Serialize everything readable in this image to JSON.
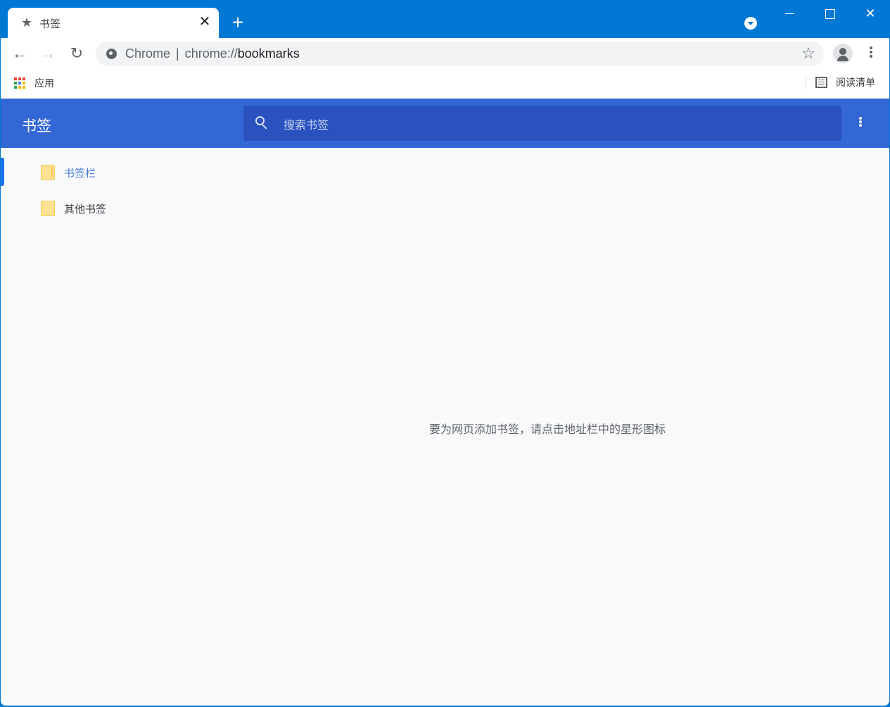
{
  "window": {
    "tab": {
      "title": "书签",
      "icon": "star-icon"
    },
    "new_tab_symbol": "+",
    "close_symbol": "✕"
  },
  "toolbar": {
    "back_symbol": "←",
    "forward_symbol": "→",
    "reload_symbol": "↻",
    "omnibox": {
      "site_label": "Chrome",
      "separator": "|",
      "url_scheme": "chrome://",
      "url_host": "bookmarks"
    },
    "star_symbol": "☆"
  },
  "bookmarks_bar": {
    "apps_label": "应用",
    "apps_colors": [
      "#ea4335",
      "#ea4335",
      "#ea4335",
      "#34a853",
      "#4285f4",
      "#fbbc04",
      "#34a853",
      "#fbbc04",
      "#fbbc04"
    ],
    "reading_list_label": "阅读清单"
  },
  "bookmarks_app": {
    "title": "书签",
    "search_placeholder": "搜索书签",
    "sidebar": {
      "items": [
        {
          "label": "书签栏",
          "selected": true
        },
        {
          "label": "其他书签",
          "selected": false
        }
      ]
    },
    "empty_message": "要为网页添加书签，请点击地址栏中的星形图标"
  },
  "colors": {
    "titlebar": "#0078d4",
    "app_header": "#3367d6",
    "search_bg": "#2a52be",
    "selected_accent": "#1a73e8",
    "folder": "#fde293"
  }
}
